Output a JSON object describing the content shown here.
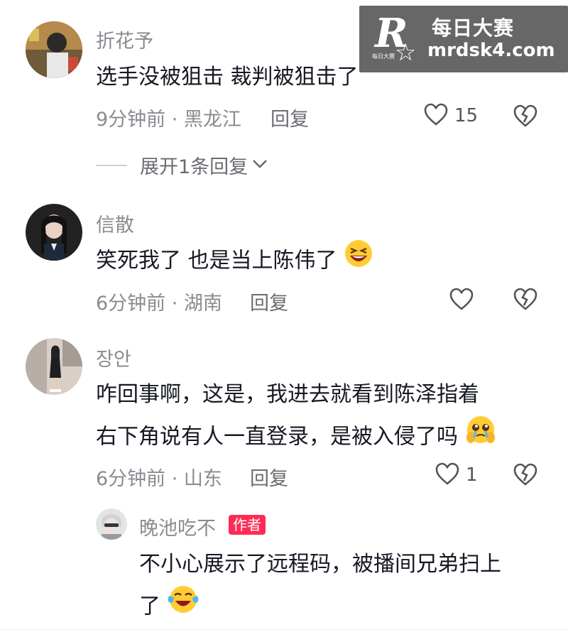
{
  "watermark": {
    "logo_letter": "R",
    "logo_small": "每日大赛",
    "brand_cn": "每日大赛",
    "url": "mrdsk4.com"
  },
  "comments": [
    {
      "user": "折花予",
      "text": "选手没被狙击 裁判被狙击了",
      "time_location": "9分钟前 · 黑龙江",
      "reply_label": "回复",
      "likes": "15",
      "expand_label": "展开1条回复"
    },
    {
      "user": "信散",
      "text": "笑死我了  也是当上陈伟了",
      "emoji": "laughing-emoji",
      "time_location": "6分钟前 · 湖南",
      "reply_label": "回复"
    },
    {
      "user": "장안",
      "text_line1": "咋回事啊，这是，我进去就看到陈泽指着",
      "text_line2": "右下角说有人一直登录，是被入侵了吗",
      "emoji": "pleading-emoji",
      "time_location": "6分钟前 · 山东",
      "reply_label": "回复",
      "likes": "1"
    }
  ],
  "reply": {
    "user": "晚池吃不",
    "badge": "作者",
    "text_line1": "不小心展示了远程码，被播间兄弟扫上",
    "text_line2": "了",
    "emoji": "crying-laughing-emoji"
  },
  "colors": {
    "text": "#161823",
    "secondary": "#8a8b91",
    "author_badge": "#fe2c55",
    "emoji_yellow": "#ffcc33"
  }
}
